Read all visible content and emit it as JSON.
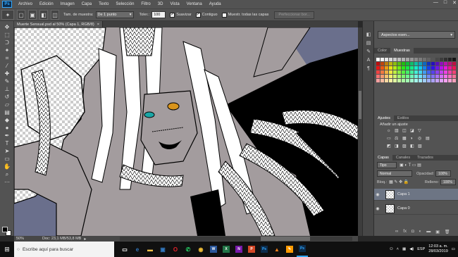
{
  "menubar": {
    "logo": "Ps",
    "items": [
      "Archivo",
      "Edición",
      "Imagen",
      "Capa",
      "Texto",
      "Selección",
      "Filtro",
      "3D",
      "Vista",
      "Ventana",
      "Ayuda"
    ],
    "window_controls": [
      "—",
      "□",
      "✕"
    ]
  },
  "options": {
    "sample_label": "Tam. de muestra:",
    "sample_value": "De 1 punto",
    "tolerance_label": "Toler.:",
    "tolerance_value": "100",
    "antialias_label": "Suavizar",
    "contiguous_label": "Contiguo",
    "all_layers_label": "Muestr. todas las capas",
    "refine_button": "Perfeccionar bor..."
  },
  "document": {
    "tab_title": "Muerte Sensual.psd al 50% (Capa 1, RGB/8)",
    "tab_close": "×",
    "zoom": "50%",
    "doc_info": "Doc: 23,1 MB/53,8 MB"
  },
  "workspace": {
    "value": "Aspectos esen..."
  },
  "color_panel": {
    "tabs": [
      "Color",
      "Muestras"
    ],
    "active": "Muestras"
  },
  "adjustments_panel": {
    "tabs": [
      "Ajustes",
      "Estilos"
    ],
    "title": "Añadir un ajuste",
    "row1": [
      "☼",
      "▥",
      "◫",
      "◪",
      "▽"
    ],
    "row2": [
      "▭",
      "⚖",
      "▦",
      "◑",
      "◎",
      "▤"
    ],
    "row3": [
      "◩",
      "◨",
      "▨",
      "◧",
      "▧"
    ]
  },
  "layers_panel": {
    "tabs": [
      "Capas",
      "Canales",
      "Trazados"
    ],
    "kind_filter": "Tipo",
    "blend_mode": "Normal",
    "opacity_label": "Opacidad:",
    "opacity_value": "100%",
    "lock_label": "Bloq.:",
    "fill_label": "Relleno:",
    "fill_value": "100%",
    "layers": [
      {
        "name": "Capa 1"
      },
      {
        "name": "Capa 0"
      }
    ]
  },
  "taskbar": {
    "search_placeholder": "Escribe aquí para buscar",
    "language": "ESP",
    "time": "12:03 a. m.",
    "date": "28/03/2019",
    "pinned": [
      {
        "icon": "task-view-icon",
        "label": "▭"
      },
      {
        "icon": "edge-icon",
        "label": "e"
      },
      {
        "icon": "explorer-icon",
        "label": "▬"
      },
      {
        "icon": "store-icon",
        "label": "▣"
      },
      {
        "icon": "opera-icon",
        "label": "O"
      },
      {
        "icon": "whatsapp-icon",
        "label": "✆"
      },
      {
        "icon": "chrome-icon",
        "label": "◉"
      },
      {
        "icon": "word-icon",
        "label": "W"
      },
      {
        "icon": "excel-icon",
        "label": "X"
      },
      {
        "icon": "onenote-icon",
        "label": "N"
      },
      {
        "icon": "powerpoint-icon",
        "label": "P"
      },
      {
        "icon": "photoshop-icon-1",
        "label": "Ps"
      },
      {
        "icon": "vlc-icon",
        "label": "▲"
      },
      {
        "icon": "illustrator-icon",
        "label": "✎"
      },
      {
        "icon": "photoshop-icon-2",
        "label": "Ps"
      }
    ]
  },
  "colors": {
    "ui_dark": "#535353",
    "canvas_bg": "#6a6f8c",
    "taskbar": "#101010",
    "accent": "#31a8ff"
  }
}
